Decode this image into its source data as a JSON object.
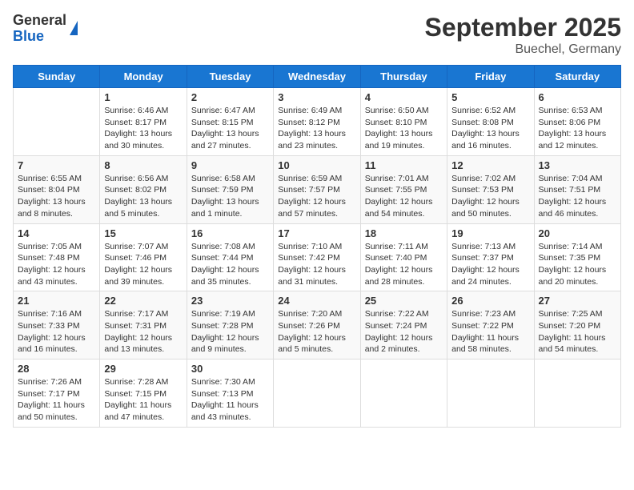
{
  "header": {
    "logo_line1": "General",
    "logo_line2": "Blue",
    "title": "September 2025",
    "subtitle": "Buechel, Germany"
  },
  "days_of_week": [
    "Sunday",
    "Monday",
    "Tuesday",
    "Wednesday",
    "Thursday",
    "Friday",
    "Saturday"
  ],
  "weeks": [
    [
      {
        "day": "",
        "info": ""
      },
      {
        "day": "1",
        "info": "Sunrise: 6:46 AM\nSunset: 8:17 PM\nDaylight: 13 hours\nand 30 minutes."
      },
      {
        "day": "2",
        "info": "Sunrise: 6:47 AM\nSunset: 8:15 PM\nDaylight: 13 hours\nand 27 minutes."
      },
      {
        "day": "3",
        "info": "Sunrise: 6:49 AM\nSunset: 8:12 PM\nDaylight: 13 hours\nand 23 minutes."
      },
      {
        "day": "4",
        "info": "Sunrise: 6:50 AM\nSunset: 8:10 PM\nDaylight: 13 hours\nand 19 minutes."
      },
      {
        "day": "5",
        "info": "Sunrise: 6:52 AM\nSunset: 8:08 PM\nDaylight: 13 hours\nand 16 minutes."
      },
      {
        "day": "6",
        "info": "Sunrise: 6:53 AM\nSunset: 8:06 PM\nDaylight: 13 hours\nand 12 minutes."
      }
    ],
    [
      {
        "day": "7",
        "info": "Sunrise: 6:55 AM\nSunset: 8:04 PM\nDaylight: 13 hours\nand 8 minutes."
      },
      {
        "day": "8",
        "info": "Sunrise: 6:56 AM\nSunset: 8:02 PM\nDaylight: 13 hours\nand 5 minutes."
      },
      {
        "day": "9",
        "info": "Sunrise: 6:58 AM\nSunset: 7:59 PM\nDaylight: 13 hours\nand 1 minute."
      },
      {
        "day": "10",
        "info": "Sunrise: 6:59 AM\nSunset: 7:57 PM\nDaylight: 12 hours\nand 57 minutes."
      },
      {
        "day": "11",
        "info": "Sunrise: 7:01 AM\nSunset: 7:55 PM\nDaylight: 12 hours\nand 54 minutes."
      },
      {
        "day": "12",
        "info": "Sunrise: 7:02 AM\nSunset: 7:53 PM\nDaylight: 12 hours\nand 50 minutes."
      },
      {
        "day": "13",
        "info": "Sunrise: 7:04 AM\nSunset: 7:51 PM\nDaylight: 12 hours\nand 46 minutes."
      }
    ],
    [
      {
        "day": "14",
        "info": "Sunrise: 7:05 AM\nSunset: 7:48 PM\nDaylight: 12 hours\nand 43 minutes."
      },
      {
        "day": "15",
        "info": "Sunrise: 7:07 AM\nSunset: 7:46 PM\nDaylight: 12 hours\nand 39 minutes."
      },
      {
        "day": "16",
        "info": "Sunrise: 7:08 AM\nSunset: 7:44 PM\nDaylight: 12 hours\nand 35 minutes."
      },
      {
        "day": "17",
        "info": "Sunrise: 7:10 AM\nSunset: 7:42 PM\nDaylight: 12 hours\nand 31 minutes."
      },
      {
        "day": "18",
        "info": "Sunrise: 7:11 AM\nSunset: 7:40 PM\nDaylight: 12 hours\nand 28 minutes."
      },
      {
        "day": "19",
        "info": "Sunrise: 7:13 AM\nSunset: 7:37 PM\nDaylight: 12 hours\nand 24 minutes."
      },
      {
        "day": "20",
        "info": "Sunrise: 7:14 AM\nSunset: 7:35 PM\nDaylight: 12 hours\nand 20 minutes."
      }
    ],
    [
      {
        "day": "21",
        "info": "Sunrise: 7:16 AM\nSunset: 7:33 PM\nDaylight: 12 hours\nand 16 minutes."
      },
      {
        "day": "22",
        "info": "Sunrise: 7:17 AM\nSunset: 7:31 PM\nDaylight: 12 hours\nand 13 minutes."
      },
      {
        "day": "23",
        "info": "Sunrise: 7:19 AM\nSunset: 7:28 PM\nDaylight: 12 hours\nand 9 minutes."
      },
      {
        "day": "24",
        "info": "Sunrise: 7:20 AM\nSunset: 7:26 PM\nDaylight: 12 hours\nand 5 minutes."
      },
      {
        "day": "25",
        "info": "Sunrise: 7:22 AM\nSunset: 7:24 PM\nDaylight: 12 hours\nand 2 minutes."
      },
      {
        "day": "26",
        "info": "Sunrise: 7:23 AM\nSunset: 7:22 PM\nDaylight: 11 hours\nand 58 minutes."
      },
      {
        "day": "27",
        "info": "Sunrise: 7:25 AM\nSunset: 7:20 PM\nDaylight: 11 hours\nand 54 minutes."
      }
    ],
    [
      {
        "day": "28",
        "info": "Sunrise: 7:26 AM\nSunset: 7:17 PM\nDaylight: 11 hours\nand 50 minutes."
      },
      {
        "day": "29",
        "info": "Sunrise: 7:28 AM\nSunset: 7:15 PM\nDaylight: 11 hours\nand 47 minutes."
      },
      {
        "day": "30",
        "info": "Sunrise: 7:30 AM\nSunset: 7:13 PM\nDaylight: 11 hours\nand 43 minutes."
      },
      {
        "day": "",
        "info": ""
      },
      {
        "day": "",
        "info": ""
      },
      {
        "day": "",
        "info": ""
      },
      {
        "day": "",
        "info": ""
      }
    ]
  ]
}
